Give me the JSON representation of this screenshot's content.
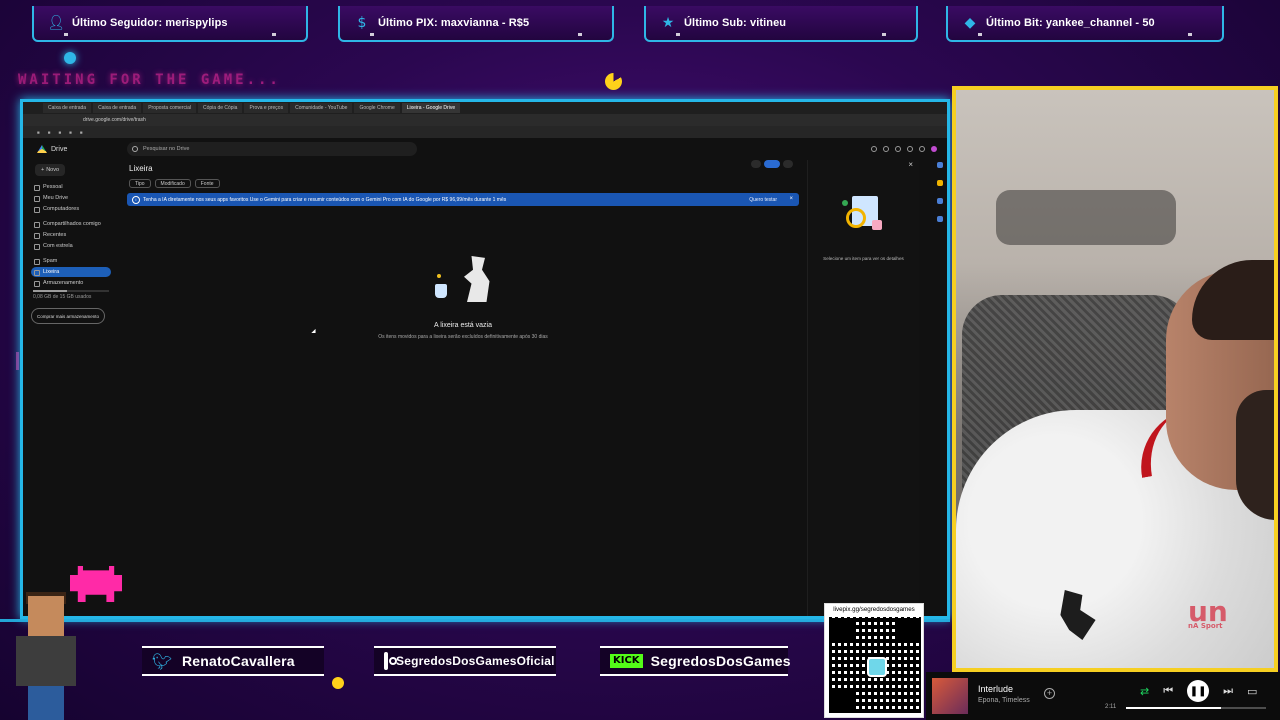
{
  "alerts": [
    {
      "icon": "person-icon",
      "text": "Último Seguidor: merispylips"
    },
    {
      "icon": "dollar-icon",
      "text": "Último PIX: maxvianna - R$5"
    },
    {
      "icon": "star-icon",
      "text": "Último Sub: vitineu"
    },
    {
      "icon": "gem-icon",
      "text": "Último Bit: yankee_channel - 50"
    }
  ],
  "waiting": "WAITING FOR THE GAME...",
  "browser": {
    "tabs": [
      "Caixa de entrada",
      "Caixa de entrada",
      "Proposta comercial",
      "Cópia de Cópia",
      "Prova e preços",
      "Comunidade - YouTube",
      "Google Chrome",
      "Lixeira - Google Drive"
    ],
    "active_tab": 7,
    "address": "drive.google.com/drive/trash"
  },
  "drive": {
    "app_name": "Drive",
    "search_placeholder": "Pesquisar no Drive",
    "new_label": "Novo",
    "sidebar": [
      "Pessoal",
      "Meu Drive",
      "Computadores",
      "Compartilhados comigo",
      "Recentes",
      "Com estrela",
      "Spam",
      "Lixeira",
      "Armazenamento"
    ],
    "selected": 7,
    "storage_text": "0,08 GB de 15 GB usados",
    "storage_fraction": 0.45,
    "buy_storage": "Comprar mais armazenamento",
    "page_title": "Lixeira",
    "filters": [
      "Tipo",
      "Modificado",
      "Fonte"
    ],
    "banner_text": "Tenha a IA diretamente nos seus apps favoritos Use o Gemini para criar e resumir conteúdos com o Gemini Pro com IA do Google por R$ 96,99/mês durante 1 mês",
    "banner_action": "Quero testar",
    "empty_title": "A lixeira está vazia",
    "empty_subtitle": "Os itens movidos para a lixeira serão excluídos definitivamente após 30 dias",
    "details_message": "Selecione um item para ver os detalhes"
  },
  "social": {
    "twitter": "RenatoCavallera",
    "instagram": "SegredosDosGamesOficial",
    "kick_badge": "KICK",
    "kick": "SegredosDosGames"
  },
  "qr": {
    "label": "livepix.gg/segredosdosgames"
  },
  "player": {
    "song": "Interlude",
    "artist": "Epona, Timeless",
    "elapsed": "2:11",
    "progress": 0.68
  },
  "colors": {
    "frame": "#25b7e8",
    "cam_border": "#f6cf22",
    "accent_pink": "#ff2ea6"
  }
}
